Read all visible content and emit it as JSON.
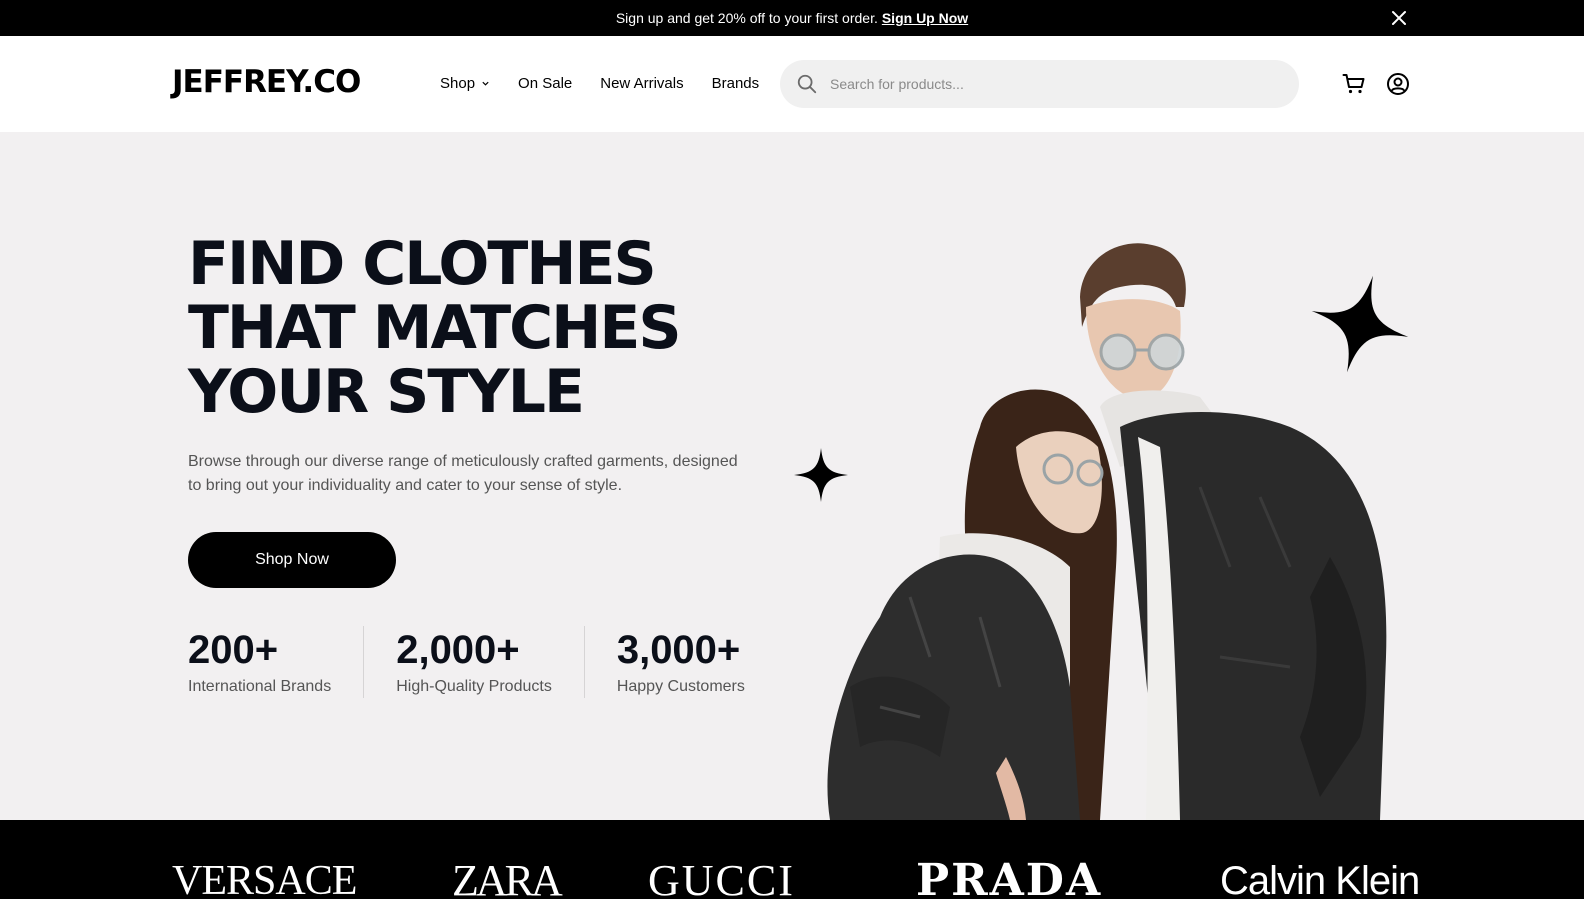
{
  "promo": {
    "text": "Sign up and get 20% off to your first order.",
    "link": "Sign Up Now"
  },
  "header": {
    "logo": "JEFFREY.CO",
    "nav": [
      "Shop",
      "On Sale",
      "New Arrivals",
      "Brands"
    ],
    "search_placeholder": "Search for products..."
  },
  "hero": {
    "headline": [
      "FIND CLOTHES",
      "THAT MATCHES",
      "YOUR STYLE"
    ],
    "subtext": "Browse through our diverse range of meticulously crafted garments, designed to bring out your individuality and cater to your sense of style.",
    "cta": "Shop Now",
    "stats": [
      {
        "value": "200+",
        "label": "International Brands"
      },
      {
        "value": "2,000+",
        "label": "High-Quality Products"
      },
      {
        "value": "3,000+",
        "label": "Happy Customers"
      }
    ]
  },
  "brands": [
    "VERSACE",
    "ZARA",
    "GUCCI",
    "PRADA",
    "Calvin Klein"
  ],
  "colors": {
    "bar": "#000000",
    "hero_bg": "#f2f0f1",
    "search_bg": "#f0f0f0",
    "headline": "#0b0f19"
  },
  "icons": [
    "close-icon",
    "chevron-down-icon",
    "search-icon",
    "cart-icon",
    "account-icon",
    "sparkle-icon"
  ]
}
